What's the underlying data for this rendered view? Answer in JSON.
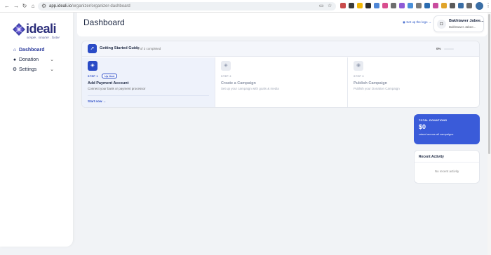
{
  "browser": {
    "url_host": "app.ideali.io",
    "url_path": "/organizer/organizer-dashboard",
    "extension_colors": [
      "#c94b4b",
      "#3b3b3b",
      "#f2b705",
      "#2d2d2d",
      "#4f87d6",
      "#d94e8f",
      "#6e6e6e",
      "#8e5bd6",
      "#4a90d9",
      "#7a7a7a",
      "#2b6cb0",
      "#c94b9e",
      "#e0a42a",
      "#5a5a5a",
      "#3a6ea5",
      "#6a6a6a"
    ]
  },
  "sidebar": {
    "logo_word": "ideali",
    "logo_tagline": "simple . smarter . faster",
    "items": [
      {
        "label": "Dashboard",
        "icon": "home-icon",
        "active": true
      },
      {
        "label": "Donation",
        "icon": "drop-icon",
        "has_chevron": true
      },
      {
        "label": "Settings",
        "icon": "gear-icon",
        "has_chevron": true
      }
    ]
  },
  "header": {
    "title": "Dashboard",
    "setup_logo": "Set up the logo →",
    "user_name": "Bakhtawer Jabee...",
    "user_sub": "Bakhtawer Jabee..."
  },
  "guide": {
    "title": "Getting Started Guide",
    "count": "0 of 3 completed",
    "percent": "0%",
    "progress": 0,
    "steps": [
      {
        "step": "STEP 1",
        "badge": "Up Next",
        "title": "Add Payment Account",
        "desc": "Connect your bank or payment processor",
        "cta": "Start now →"
      },
      {
        "step": "STEP 2",
        "title": "Create a Campaign",
        "desc": "Set up your campaign with goals & media"
      },
      {
        "step": "STEP 3",
        "title": "Publish Campaign",
        "desc": "Publish your Donation Campaign"
      }
    ]
  },
  "donations": {
    "label": "TOTAL DONATIONS",
    "value": "$0",
    "sub": "raised across all campaigns"
  },
  "recent": {
    "title": "Recent Activity",
    "empty": "No recent activity"
  },
  "colors": {
    "accent": "#2a4bc6",
    "donation_card": "#3a5bd9",
    "brand": "#2b2d7a"
  }
}
